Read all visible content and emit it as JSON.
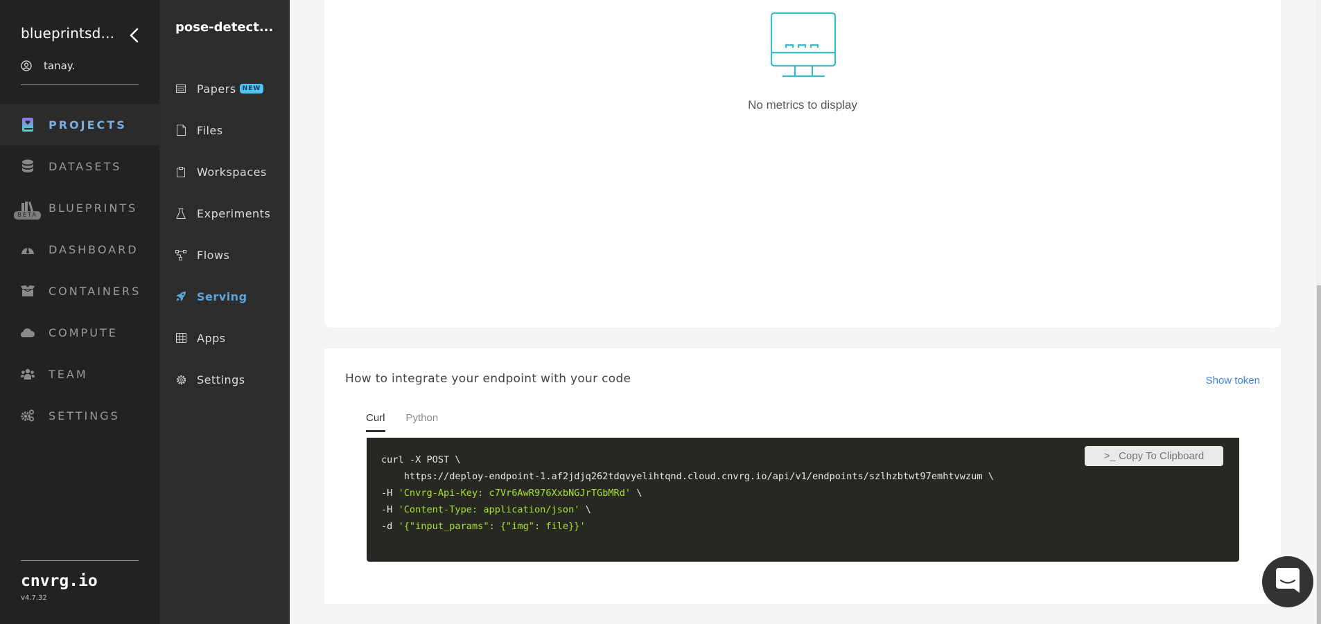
{
  "sidebar": {
    "org_name": "blueprintsd...",
    "user_name": "tanay.",
    "items": [
      {
        "label": "PROJECTS",
        "icon": "projects-book-icon",
        "active": true
      },
      {
        "label": "DATASETS",
        "icon": "database-icon"
      },
      {
        "label": "BLUEPRINTS",
        "icon": "books-icon",
        "badge": "BETA"
      },
      {
        "label": "DASHBOARD",
        "icon": "gauge-icon"
      },
      {
        "label": "CONTAINERS",
        "icon": "box-icon"
      },
      {
        "label": "COMPUTE",
        "icon": "cloud-icon"
      },
      {
        "label": "TEAM",
        "icon": "users-icon"
      },
      {
        "label": "SETTINGS",
        "icon": "cogs-icon"
      }
    ],
    "brand": "cnvrg.io",
    "version": "v4.7.32"
  },
  "project_nav": {
    "project_name": "pose-detect...",
    "items": [
      {
        "label": "Papers",
        "icon": "papers-icon",
        "badge": "NEW"
      },
      {
        "label": "Files",
        "icon": "file-icon"
      },
      {
        "label": "Workspaces",
        "icon": "clipboard-icon"
      },
      {
        "label": "Experiments",
        "icon": "flask-icon"
      },
      {
        "label": "Flows",
        "icon": "flow-icon"
      },
      {
        "label": "Serving",
        "icon": "rocket-icon",
        "active": true
      },
      {
        "label": "Apps",
        "icon": "grid-icon"
      },
      {
        "label": "Settings",
        "icon": "gear-icon"
      }
    ]
  },
  "metrics": {
    "empty_text": "No metrics to display",
    "icon": "monitor-icon"
  },
  "integration": {
    "title": "How to integrate your endpoint with your code",
    "show_token": "Show token",
    "tabs": [
      {
        "label": "Curl",
        "active": true
      },
      {
        "label": "Python"
      }
    ],
    "copy_button": ">_ Copy To Clipboard",
    "code_lines": [
      {
        "plain": "curl -X POST \\",
        "str": "",
        "tail": ""
      },
      {
        "plain": "    https://deploy-endpoint-1.af2jdjq262tdqvyelihtqnd.cloud.cnvrg.io/api/v1/endpoints/szlhzbtwt97emhtvwzum \\",
        "str": "",
        "tail": ""
      },
      {
        "plain": "-H ",
        "str": "'Cnvrg-Api-Key: c7Vr6AwR976XxbNGJrTGbMRd'",
        "tail": " \\"
      },
      {
        "plain": "-H ",
        "str": "'Content-Type: application/json'",
        "tail": " \\"
      },
      {
        "plain": "-d ",
        "str": "'{\"input_params\": {\"img\": file}}'",
        "tail": ""
      }
    ]
  },
  "chat": {
    "icon": "chat-icon"
  },
  "colors": {
    "sidebar_bg": "#222222",
    "project_nav_bg": "#2c2c2c",
    "active_accent": "#5ba4dc",
    "code_bg": "#282822",
    "code_string": "#a6e22e",
    "link": "#3a86d6",
    "monitor_icon": "#3bb8c9"
  }
}
